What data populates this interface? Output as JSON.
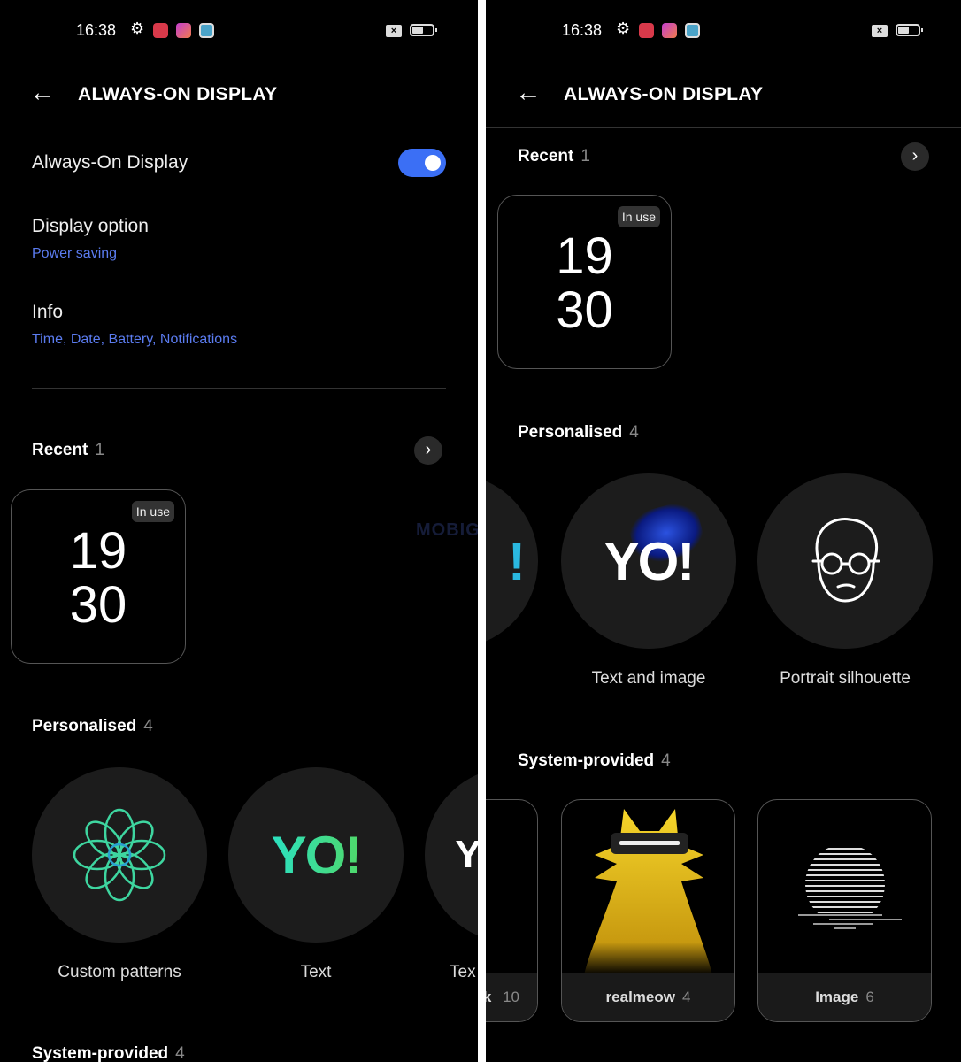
{
  "status_bar": {
    "time": "16:38",
    "icons": [
      "gear-icon",
      "red-app-icon",
      "pink-app-icon",
      "teal-app-icon",
      "close-box-icon",
      "battery-icon"
    ]
  },
  "header": {
    "title": "ALWAYS-ON DISPLAY",
    "back_icon": "arrow-left-icon"
  },
  "settings": {
    "aod_label": "Always-On Display",
    "aod_on": true,
    "display_option_label": "Display option",
    "display_option_value": "Power saving",
    "info_label": "Info",
    "info_value": "Time, Date, Battery, Notifications"
  },
  "recent": {
    "label": "Recent",
    "count": "1",
    "card": {
      "badge": "In use",
      "hour": "19",
      "minute": "30"
    }
  },
  "personalised": {
    "label": "Personalised",
    "count": "4",
    "items": [
      {
        "label": "Custom patterns"
      },
      {
        "label": "Text",
        "art": "YO!"
      },
      {
        "label": "Text and image",
        "partial": "Tex",
        "art": "YO!"
      },
      {
        "label": "Portrait silhouette"
      }
    ]
  },
  "system": {
    "label": "System-provided",
    "count": "4",
    "items": [
      {
        "label": "k",
        "count": "10"
      },
      {
        "label": "realmeow",
        "count": "4"
      },
      {
        "label": "Image",
        "count": "6"
      }
    ]
  },
  "watermark": "MOBIGYAAN",
  "colors": {
    "accent": "#3b6ff5",
    "link": "#5b7cf0",
    "bg": "#000000",
    "circle": "#1c1c1c"
  }
}
